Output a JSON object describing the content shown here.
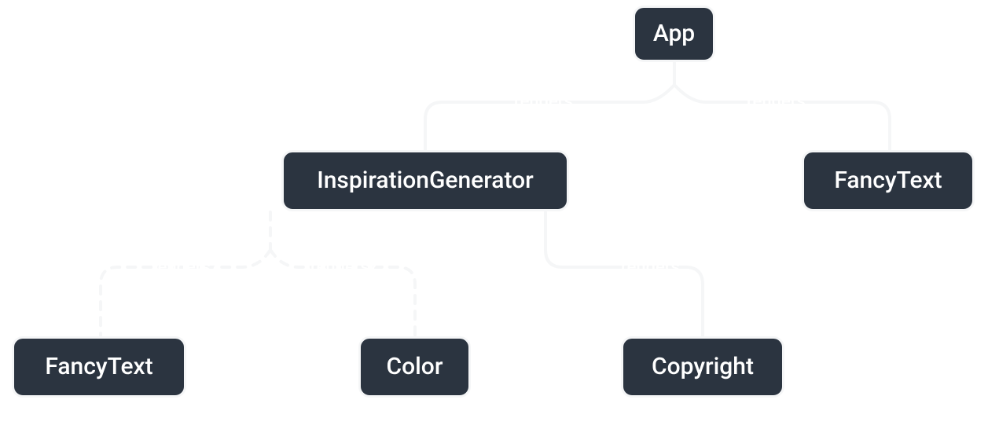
{
  "diagram": {
    "nodes": {
      "app": "App",
      "inspiration_generator": "InspirationGenerator",
      "fancytext_right": "FancyText",
      "fancytext_left": "FancyText",
      "color": "Color",
      "copyright": "Copyright"
    },
    "edges": {
      "app_to_inspiration": "renders",
      "app_to_fancytext": "renders",
      "inspiration_to_fancytext": "renders?",
      "inspiration_to_color": "renders?",
      "inspiration_to_copyright": "renders"
    },
    "colors": {
      "node_fill": "#2b3440",
      "node_border": "#f5f6f7",
      "edge_stroke": "#f5f6f7",
      "text": "#ffffff"
    },
    "styles": {
      "solid_edge": "solid",
      "dashed_edge": "dashed"
    }
  }
}
